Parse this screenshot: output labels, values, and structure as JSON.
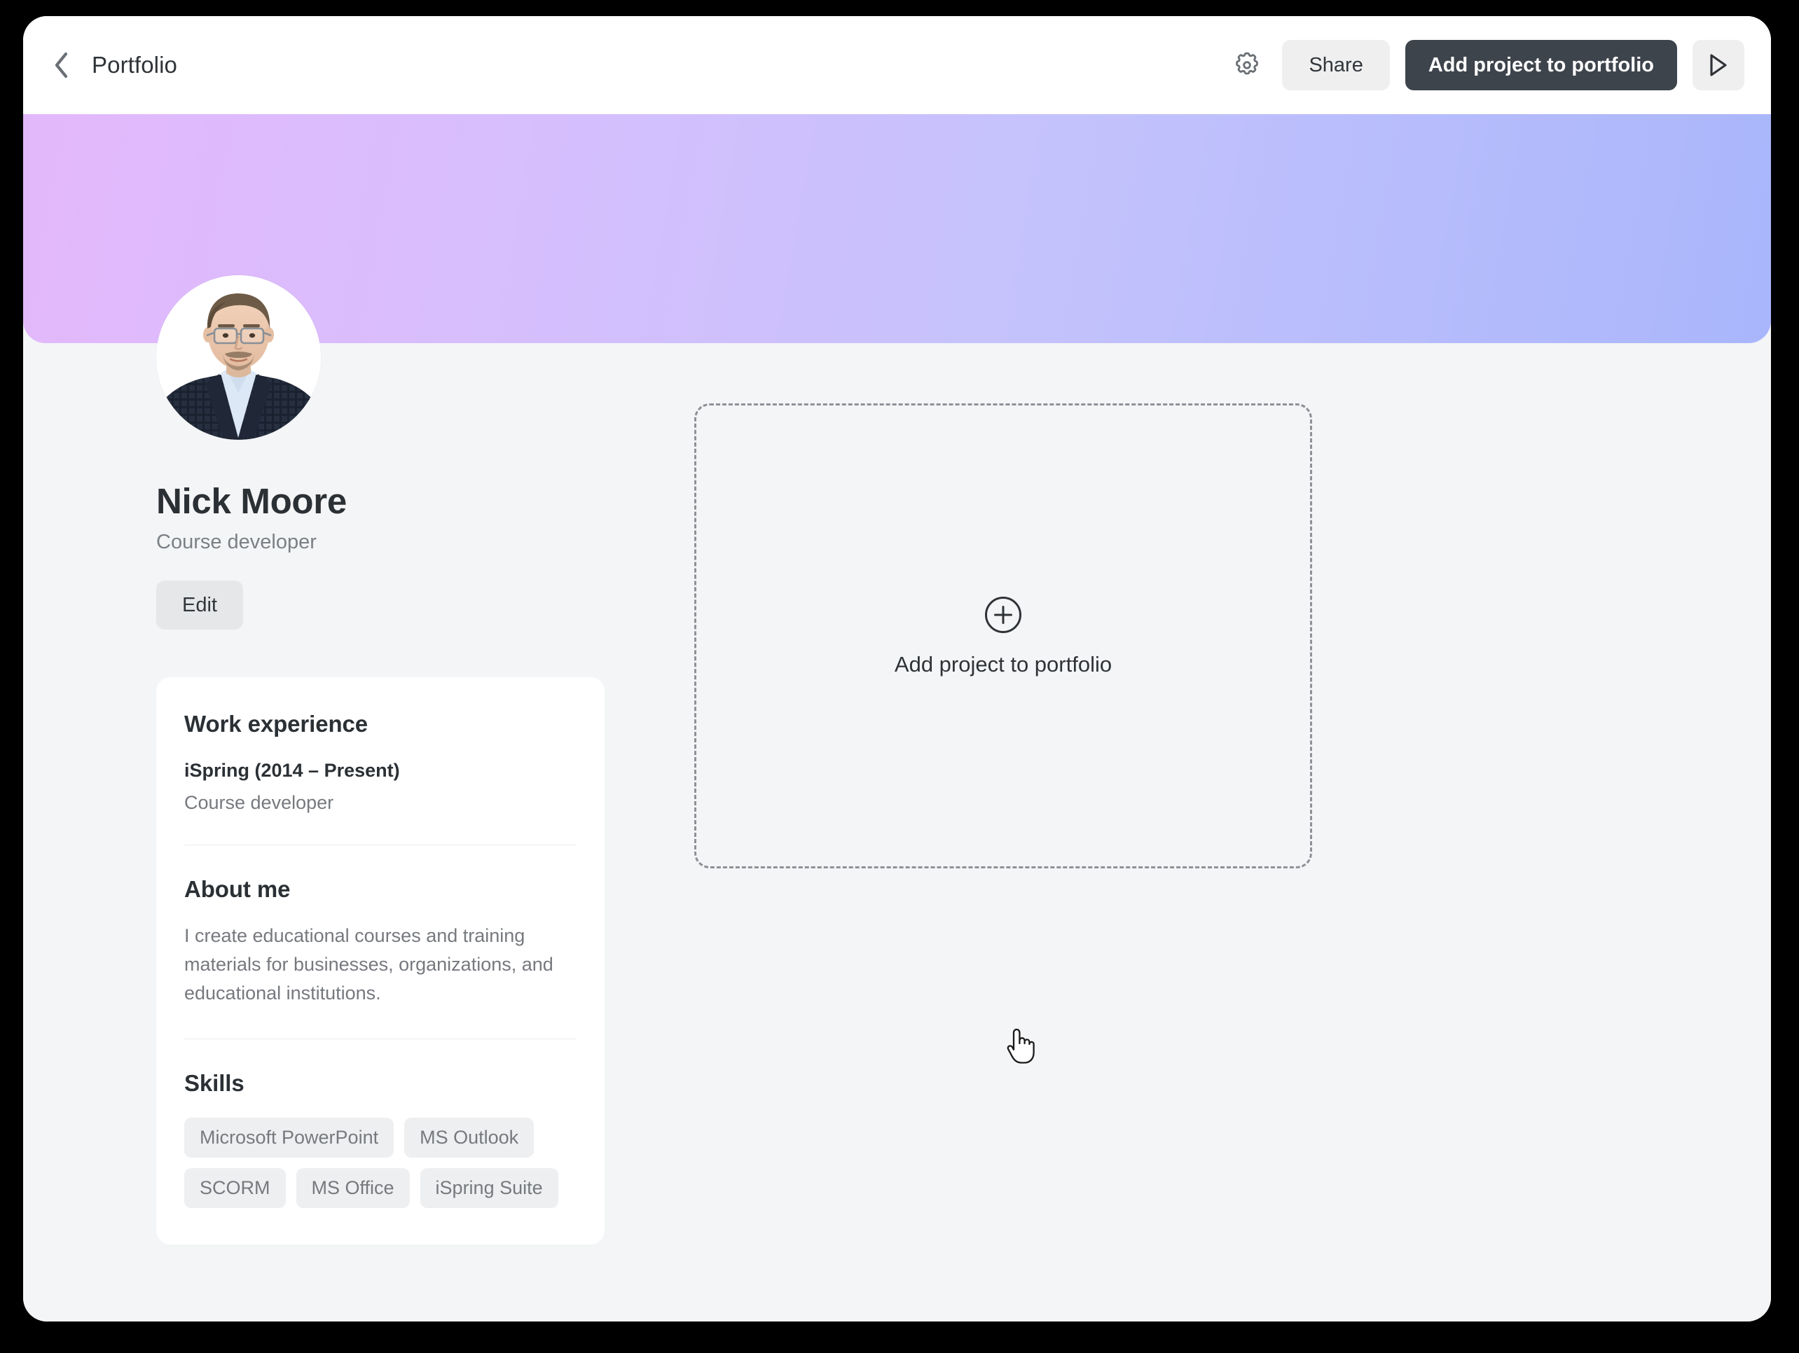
{
  "header": {
    "back_icon": "chevron-left-icon",
    "title": "Portfolio",
    "gear_icon": "gear-icon",
    "share_label": "Share",
    "add_project_label": "Add project to portfolio",
    "preview_icon": "play-icon"
  },
  "banner": {
    "gradient_from": "#e3b8fb",
    "gradient_to": "#a9b6fb"
  },
  "profile": {
    "avatar_alt": "avatar",
    "name": "Nick Moore",
    "role": "Course developer",
    "edit_label": "Edit"
  },
  "info_card": {
    "work_experience_heading": "Work experience",
    "job_title": "iSpring (2014 – Present)",
    "job_role": "Course developer",
    "about_heading": "About me",
    "about_text": "I create educational courses and training materials for businesses, organizations, and educational institutions.",
    "skills_heading": "Skills",
    "skills": [
      "Microsoft PowerPoint",
      "MS Outlook",
      "SCORM",
      "MS Office",
      "iSpring Suite"
    ]
  },
  "dropzone": {
    "plus_icon": "plus-circle-icon",
    "label": "Add project to portfolio"
  },
  "cursor": {
    "type": "pointing-hand-cursor"
  }
}
